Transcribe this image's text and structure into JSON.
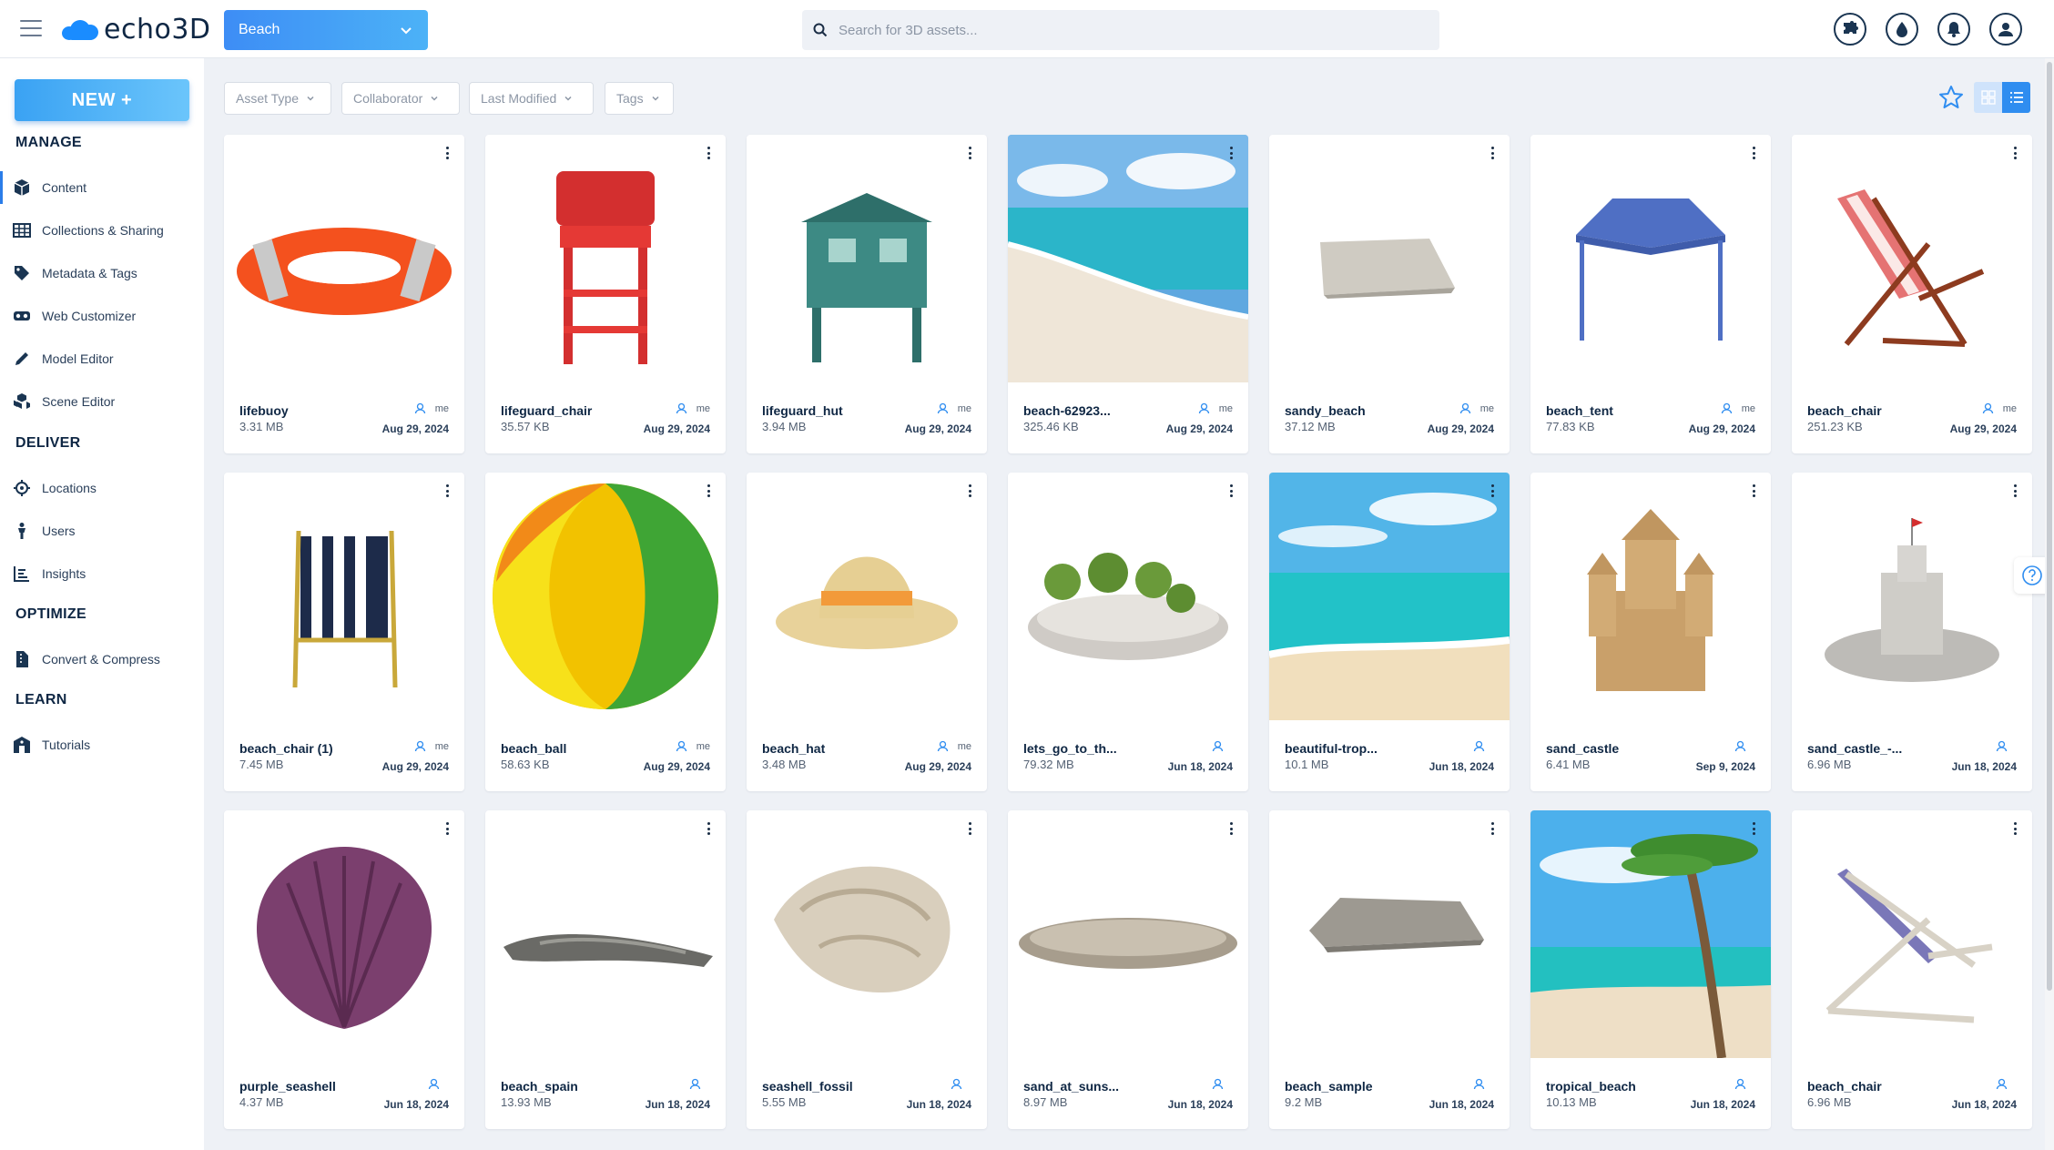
{
  "app": {
    "logo_text": "echo3D",
    "brand_color": "#1a8cff",
    "accent_color": "#2f8df0"
  },
  "header": {
    "project": "Beach",
    "search_placeholder": "Search for 3D assets...",
    "icons": [
      "puzzle-icon",
      "water-drop-icon",
      "bell-icon",
      "account-icon"
    ]
  },
  "sidebar": {
    "new_label": "NEW +",
    "sections": {
      "manage": "MANAGE",
      "deliver": "DELIVER",
      "optimize": "OPTIMIZE",
      "learn": "LEARN"
    },
    "items": {
      "content": "Content",
      "collections": "Collections & Sharing",
      "metadata": "Metadata & Tags",
      "web_customizer": "Web Customizer",
      "model_editor": "Model Editor",
      "scene_editor": "Scene Editor",
      "locations": "Locations",
      "users": "Users",
      "insights": "Insights",
      "convert": "Convert & Compress",
      "tutorials": "Tutorials"
    }
  },
  "filters": {
    "asset_type": "Asset Type",
    "collaborator": "Collaborator",
    "last_modified": "Last Modified",
    "tags": "Tags"
  },
  "assets": [
    {
      "name": "lifebuoy",
      "size": "3.31 MB",
      "owner": "me",
      "date": "Aug 29, 2024"
    },
    {
      "name": "lifeguard_chair",
      "size": "35.57 KB",
      "owner": "me",
      "date": "Aug 29, 2024"
    },
    {
      "name": "lifeguard_hut",
      "size": "3.94 MB",
      "owner": "me",
      "date": "Aug 29, 2024"
    },
    {
      "name": "beach-62923...",
      "size": "325.46 KB",
      "owner": "me",
      "date": "Aug 29, 2024"
    },
    {
      "name": "sandy_beach",
      "size": "37.12 MB",
      "owner": "me",
      "date": "Aug 29, 2024"
    },
    {
      "name": "beach_tent",
      "size": "77.83 KB",
      "owner": "me",
      "date": "Aug 29, 2024"
    },
    {
      "name": "beach_chair",
      "size": "251.23 KB",
      "owner": "me",
      "date": "Aug 29, 2024"
    },
    {
      "name": "beach_chair (1)",
      "size": "7.45 MB",
      "owner": "me",
      "date": "Aug 29, 2024"
    },
    {
      "name": "beach_ball",
      "size": "58.63 KB",
      "owner": "me",
      "date": "Aug 29, 2024"
    },
    {
      "name": "beach_hat",
      "size": "3.48 MB",
      "owner": "me",
      "date": "Aug 29, 2024"
    },
    {
      "name": "lets_go_to_th...",
      "size": "79.32 MB",
      "owner": "",
      "date": "Jun 18, 2024"
    },
    {
      "name": "beautiful-trop...",
      "size": "10.1 MB",
      "owner": "",
      "date": "Jun 18, 2024"
    },
    {
      "name": "sand_castle",
      "size": "6.41 MB",
      "owner": "",
      "date": "Sep 9, 2024"
    },
    {
      "name": "sand_castle_-...",
      "size": "6.96 MB",
      "owner": "",
      "date": "Jun 18, 2024"
    },
    {
      "name": "purple_seashell",
      "size": "4.37 MB",
      "owner": "",
      "date": "Jun 18, 2024"
    },
    {
      "name": "beach_spain",
      "size": "13.93 MB",
      "owner": "",
      "date": "Jun 18, 2024"
    },
    {
      "name": "seashell_fossil",
      "size": "5.55 MB",
      "owner": "",
      "date": "Jun 18, 2024"
    },
    {
      "name": "sand_at_suns...",
      "size": "8.97 MB",
      "owner": "",
      "date": "Jun 18, 2024"
    },
    {
      "name": "beach_sample",
      "size": "9.2 MB",
      "owner": "",
      "date": "Jun 18, 2024"
    },
    {
      "name": "tropical_beach",
      "size": "10.13 MB",
      "owner": "",
      "date": "Jun 18, 2024"
    },
    {
      "name": "beach_chair",
      "size": "6.96 MB",
      "owner": "",
      "date": "Jun 18, 2024"
    }
  ]
}
